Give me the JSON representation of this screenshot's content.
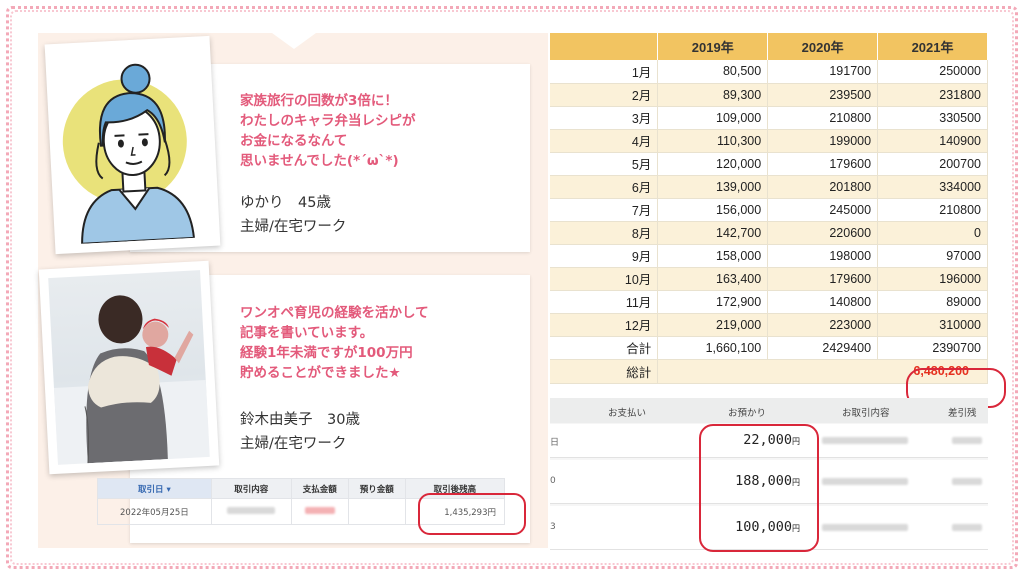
{
  "testimonials": [
    {
      "message": [
        "家族旅行の回数が3倍に！",
        "わたしのキャラ弁当レシピが",
        "お金になるなんて",
        "思いませんでした(*´ω`*)"
      ],
      "name": "ゆかり　45歳",
      "role": "主婦/在宅ワーク"
    },
    {
      "message": [
        "ワンオペ育児の経験を活かして",
        "記事を書いています。",
        "経験1年未満ですが100万円",
        "貯めることができました★"
      ],
      "name": "鈴木由美子　30歳",
      "role": "主婦/在宅ワーク"
    }
  ],
  "bank_table": {
    "headers": [
      "取引日 ▾",
      "取引内容",
      "支払金額",
      "預り金額",
      "取引後残高"
    ],
    "row": {
      "date": "2022年05月25日",
      "balance": "1,435,293円"
    }
  },
  "income_table": {
    "headers": [
      "",
      "2019年",
      "2020年",
      "2021年"
    ],
    "rows": [
      {
        "month": "1月",
        "y2019": "80,500",
        "y2020": "191700",
        "y2021": "250000"
      },
      {
        "month": "2月",
        "y2019": "89,300",
        "y2020": "239500",
        "y2021": "231800"
      },
      {
        "month": "3月",
        "y2019": "109,000",
        "y2020": "210800",
        "y2021": "330500"
      },
      {
        "month": "4月",
        "y2019": "110,300",
        "y2020": "199000",
        "y2021": "140900"
      },
      {
        "month": "5月",
        "y2019": "120,000",
        "y2020": "179600",
        "y2021": "200700"
      },
      {
        "month": "6月",
        "y2019": "139,000",
        "y2020": "201800",
        "y2021": "334000"
      },
      {
        "month": "7月",
        "y2019": "156,000",
        "y2020": "245000",
        "y2021": "210800"
      },
      {
        "month": "8月",
        "y2019": "142,700",
        "y2020": "220600",
        "y2021": "0"
      },
      {
        "month": "9月",
        "y2019": "158,000",
        "y2020": "198000",
        "y2021": "97000"
      },
      {
        "month": "10月",
        "y2019": "163,400",
        "y2020": "179600",
        "y2021": "196000"
      },
      {
        "month": "11月",
        "y2019": "172,900",
        "y2020": "140800",
        "y2021": "89000"
      },
      {
        "month": "12月",
        "y2019": "219,000",
        "y2020": "223000",
        "y2021": "310000"
      }
    ],
    "total": {
      "label": "合計",
      "y2019": "1,660,100",
      "y2020": "2429400",
      "y2021": "2390700"
    },
    "grand_total": {
      "label": "総計",
      "value": "6,480,200"
    }
  },
  "deposit_table": {
    "headers": [
      "お支払い",
      "お預かり",
      "お取引内容",
      "差引残"
    ],
    "rows": [
      {
        "edge": "日",
        "amount": "22,000",
        "unit": "円"
      },
      {
        "edge": "0",
        "amount": "188,000",
        "unit": "円"
      },
      {
        "edge": "3",
        "amount": "100,000",
        "unit": "円"
      }
    ]
  },
  "colors": {
    "accent_pink": "#e35a7b",
    "table_header": "#f2c461",
    "highlight_red": "#d9273a"
  },
  "icons": [
    "woman-illustration",
    "mother-child-photo"
  ]
}
